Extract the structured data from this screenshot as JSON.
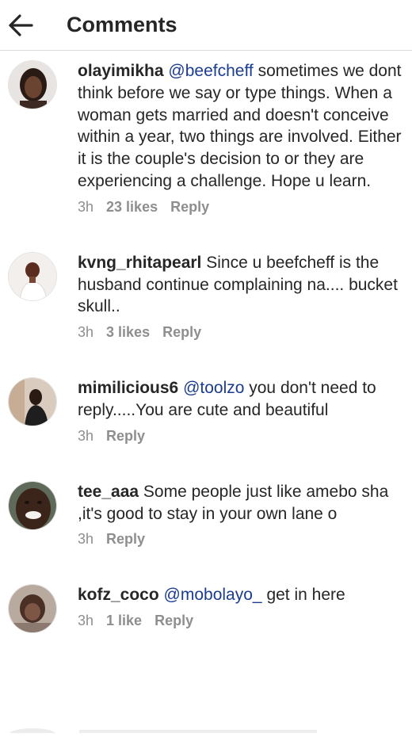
{
  "header": {
    "title": "Comments"
  },
  "comments": [
    {
      "username": "olayimikha",
      "mention": "@beefcheff",
      "text": " sometimes we dont think before we say or type things. When a woman gets married and doesn't conceive within a year, two things are involved. Either it is the couple's decision  to or they are experiencing a challenge. Hope u learn.",
      "time": "3h",
      "likes": "23 likes",
      "reply": "Reply"
    },
    {
      "username": "kvng_rhitapearl",
      "mention": "",
      "text": " Since u beefcheff is the husband continue complaining na.... bucket skull..",
      "time": "3h",
      "likes": "3 likes",
      "reply": "Reply"
    },
    {
      "username": "mimilicious6",
      "mention": "@toolzo",
      "text": " you don't need to reply.....You are cute and beautiful",
      "time": "3h",
      "likes": "",
      "reply": "Reply"
    },
    {
      "username": "tee_aaa",
      "mention": "",
      "text": " Some people just like amebo sha ,it's good to stay in your own lane o",
      "time": "3h",
      "likes": "",
      "reply": "Reply"
    },
    {
      "username": "kofz_coco",
      "mention": "@mobolayo_",
      "text": " get in here",
      "time": "3h",
      "likes": "1 like",
      "reply": "Reply"
    }
  ]
}
